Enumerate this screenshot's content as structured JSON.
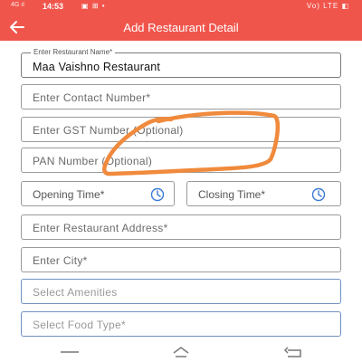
{
  "status_bar": {
    "time": "14:53",
    "left_indicator": "4G ıl",
    "notification_icons": "▣ ⊞ •",
    "right_indicators": "Vo) LTE ◧"
  },
  "app_bar": {
    "title": "Add Restaurant Detail",
    "back_icon": "back-arrow-icon"
  },
  "form": {
    "restaurant_name": {
      "label": "Enter Restaurant Name*",
      "value": "Maa Vaishno Restaurant"
    },
    "contact_number": {
      "label": "Enter Contact Number*"
    },
    "gst_number": {
      "label": "Enter GST Number (Optional)"
    },
    "pan_number": {
      "label": "PAN Number (Optional)"
    },
    "opening_time": {
      "label": "Opening Time*",
      "icon": "clock-icon"
    },
    "closing_time": {
      "label": "Closing Time*",
      "icon": "clock-icon"
    },
    "restaurant_address": {
      "label": "Enter Restaurant Address*"
    },
    "city": {
      "label": "Enter City*"
    },
    "amenities": {
      "label": "Select Amenities"
    },
    "food_type": {
      "label": "Select Food Type*"
    }
  },
  "annotation": {
    "color": "#f08a3c",
    "shape": "hand-drawn circle around GST and PAN fields"
  },
  "colors": {
    "accent": "#f0554c",
    "time_icon": "#3a7bd5",
    "select_border": "#6f93c0"
  },
  "nav_bar": {
    "buttons": [
      "recents-icon",
      "home-icon",
      "back-icon"
    ]
  }
}
